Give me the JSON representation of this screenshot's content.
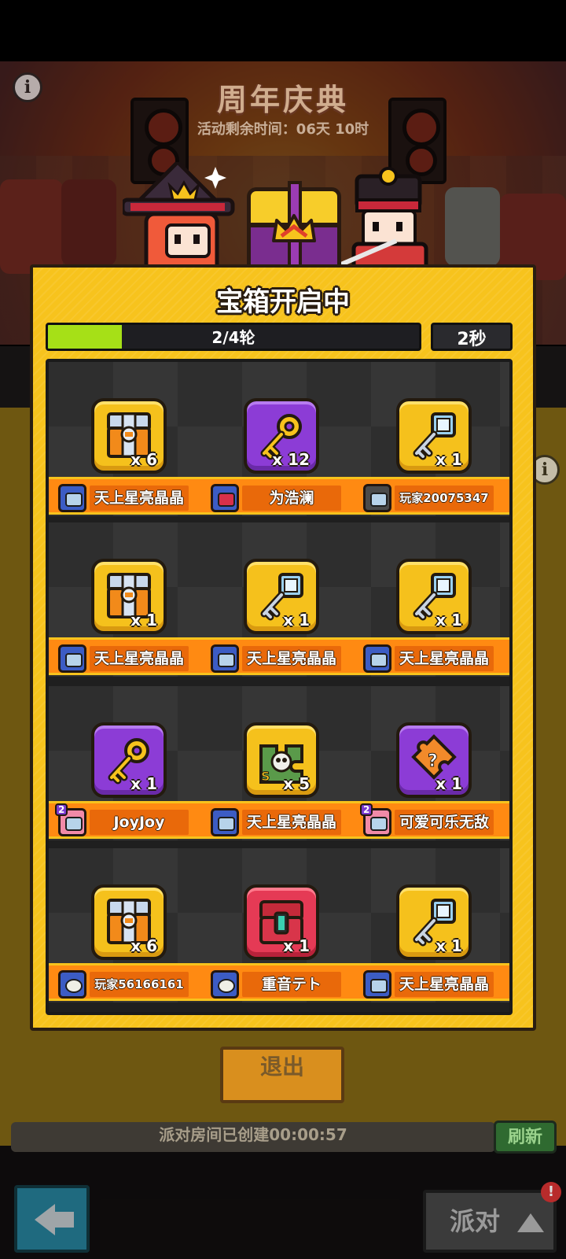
{
  "event": {
    "title": "周年庆典",
    "timer": "活动剩余时间：06天 10时"
  },
  "panel": {
    "title": "宝箱开启中",
    "progress_label": "2/4轮",
    "progress_fraction": 0.2,
    "countdown": "2秒"
  },
  "rounds": [
    [
      {
        "item": "chest-icon",
        "style": "gold",
        "qty": "x 6",
        "player": "天上星亮晶晶",
        "avatar": "camera"
      },
      {
        "item": "gold-key-icon",
        "style": "purple",
        "qty": "x 12",
        "player": "为浩澜",
        "avatar": "red"
      },
      {
        "item": "silver-key-icon",
        "style": "gold",
        "qty": "x 1",
        "player": "玩家20075347",
        "avatar": "mono"
      }
    ],
    [
      {
        "item": "chest-icon",
        "style": "gold",
        "qty": "x 1",
        "player": "天上星亮晶晶",
        "avatar": "camera"
      },
      {
        "item": "silver-key-icon",
        "style": "gold",
        "qty": "x 1",
        "player": "天上星亮晶晶",
        "avatar": "camera"
      },
      {
        "item": "silver-key-icon",
        "style": "gold",
        "qty": "x 1",
        "player": "天上星亮晶晶",
        "avatar": "camera"
      }
    ],
    [
      {
        "item": "gold-key-icon",
        "style": "purple",
        "qty": "x 1",
        "player": "JoyJoy",
        "avatar": "pink",
        "level": "2"
      },
      {
        "item": "skin-fragment-icon",
        "style": "gold",
        "qty": "x 5",
        "player": "天上星亮晶晶",
        "avatar": "camera"
      },
      {
        "item": "mystery-puzzle-icon",
        "style": "purple",
        "qty": "x 1",
        "player": "可爱可乐无敌",
        "avatar": "pink",
        "level": "2"
      }
    ],
    [
      {
        "item": "chest-icon",
        "style": "gold",
        "qty": "x 6",
        "player": "玩家56166161",
        "avatar": "skull"
      },
      {
        "item": "red-chest-icon",
        "style": "red",
        "qty": "x 1",
        "player": "重音テト",
        "avatar": "skull"
      },
      {
        "item": "silver-key-icon",
        "style": "gold",
        "qty": "x 1",
        "player": "天上星亮晶晶",
        "avatar": "camera"
      }
    ]
  ],
  "footer": {
    "exit_label": "退出",
    "party_status": "派对房间已创建00:00:57",
    "refresh_label": "刷新",
    "party_label": "派对",
    "badge": "!"
  },
  "colors": {
    "panel": "#f7c31d",
    "progress_fill": "#a6e017",
    "name_bar": "#ff8a12"
  }
}
